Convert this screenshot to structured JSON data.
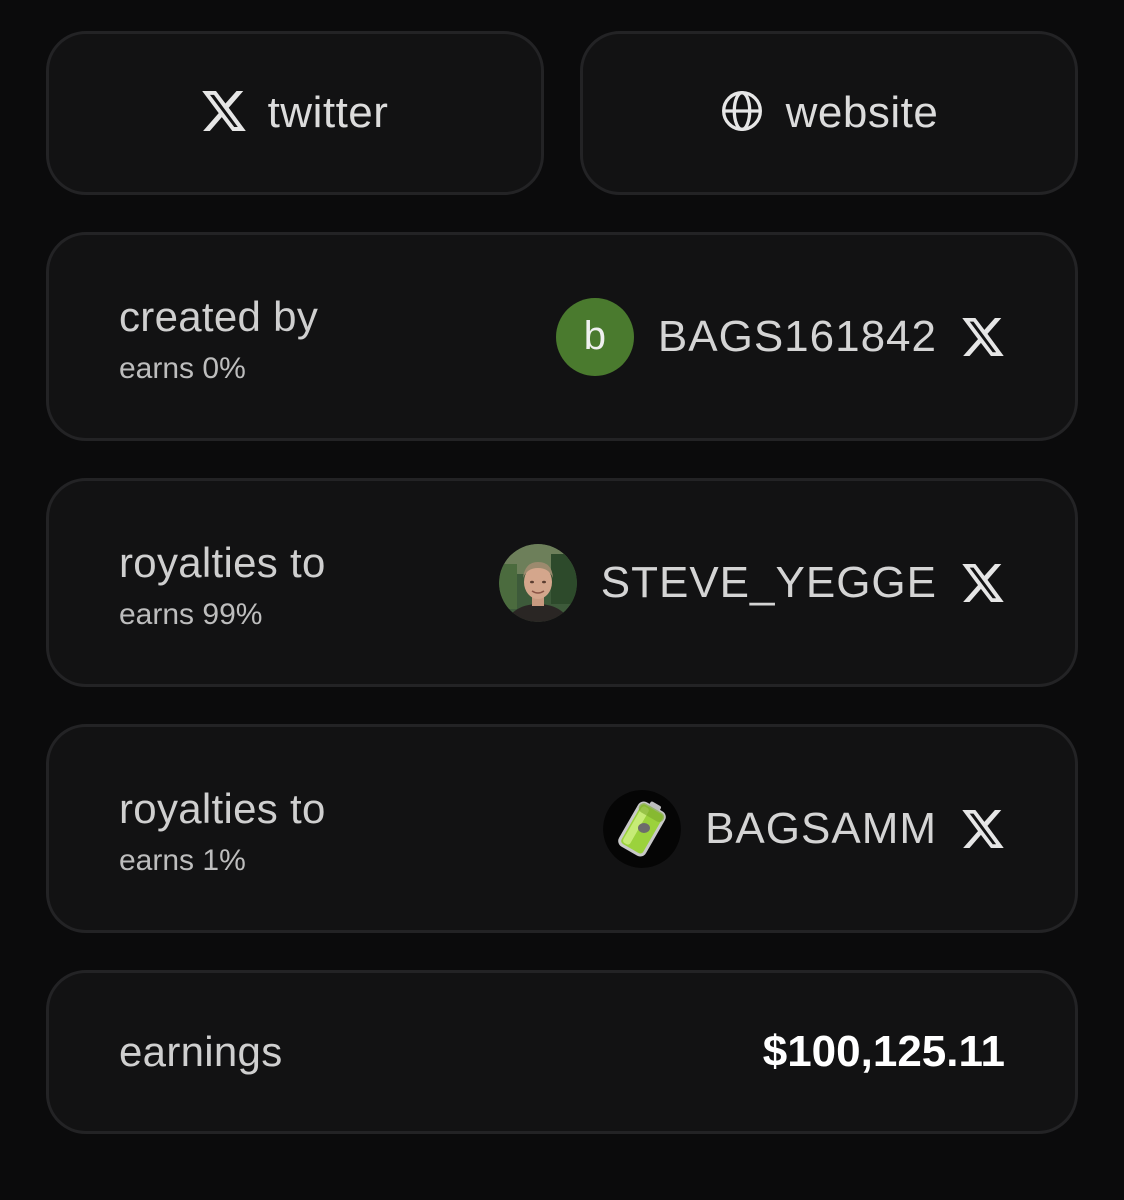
{
  "links": {
    "twitter_label": "twitter",
    "website_label": "website"
  },
  "creator": {
    "title": "created by",
    "earns": "earns 0%",
    "avatar_letter": "b",
    "avatar_color": "#4a7a2e",
    "username": "BAGS161842"
  },
  "royalties": [
    {
      "title": "royalties to",
      "earns": "earns 99%",
      "username": "STEVE_YEGGE",
      "avatar": "person-photo"
    },
    {
      "title": "royalties to",
      "earns": "earns 1%",
      "username": "BAGSAMM",
      "avatar": "green-battery-icon"
    }
  ],
  "earnings": {
    "label": "earnings",
    "value": "$100,125.11"
  },
  "colors": {
    "background": "#0b0b0c",
    "card": "#121213",
    "card_border": "#232325",
    "text": "#d4d4d4",
    "value": "#ffffff"
  }
}
